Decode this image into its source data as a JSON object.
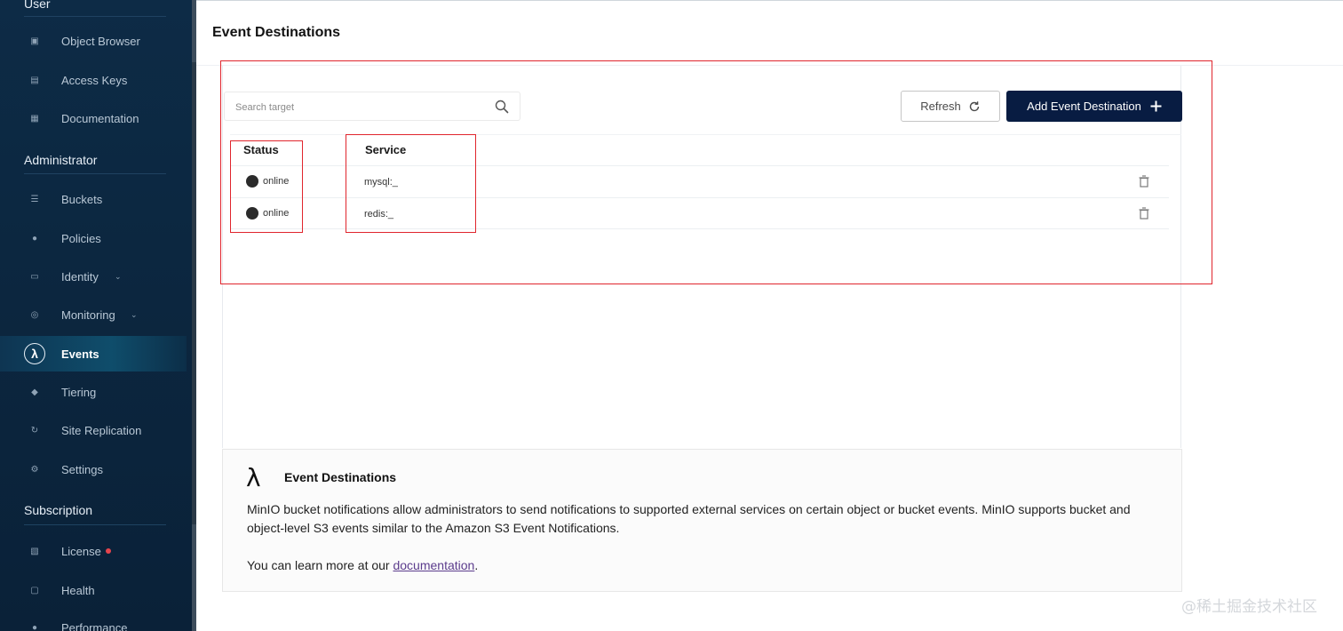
{
  "sidebar": {
    "sections": {
      "user": "User",
      "administrator": "Administrator",
      "subscription": "Subscription"
    },
    "items": {
      "object_browser": "Object Browser",
      "access_keys": "Access Keys",
      "documentation": "Documentation",
      "buckets": "Buckets",
      "policies": "Policies",
      "identity": "Identity",
      "monitoring": "Monitoring",
      "events": "Events",
      "tiering": "Tiering",
      "site_replication": "Site Replication",
      "settings": "Settings",
      "license": "License",
      "health": "Health",
      "performance": "Performance"
    },
    "active_item": "events"
  },
  "main": {
    "title": "Event Destinations",
    "search": {
      "placeholder": "Search target",
      "value": ""
    },
    "buttons": {
      "refresh": "Refresh",
      "add": "Add Event Destination"
    },
    "table": {
      "headers": {
        "status": "Status",
        "service": "Service"
      },
      "rows": [
        {
          "status": "online",
          "service": "mysql:_"
        },
        {
          "status": "online",
          "service": "redis:_"
        }
      ]
    },
    "help": {
      "title": "Event Destinations",
      "body": "MinIO bucket notifications allow administrators to send notifications to supported external services on certain object or bucket events. MinIO supports bucket and object-level S3 events similar to the Amazon S3 Event Notifications.",
      "more_prefix": "You can learn more at our ",
      "more_link": "documentation",
      "more_suffix": "."
    }
  },
  "watermark": "@稀土掘金技术社区",
  "colors": {
    "sidebar_bg": "#0c2740",
    "primary_button": "#081c42",
    "annotation_red": "#e0252d",
    "license_dot": "#e5454d"
  }
}
